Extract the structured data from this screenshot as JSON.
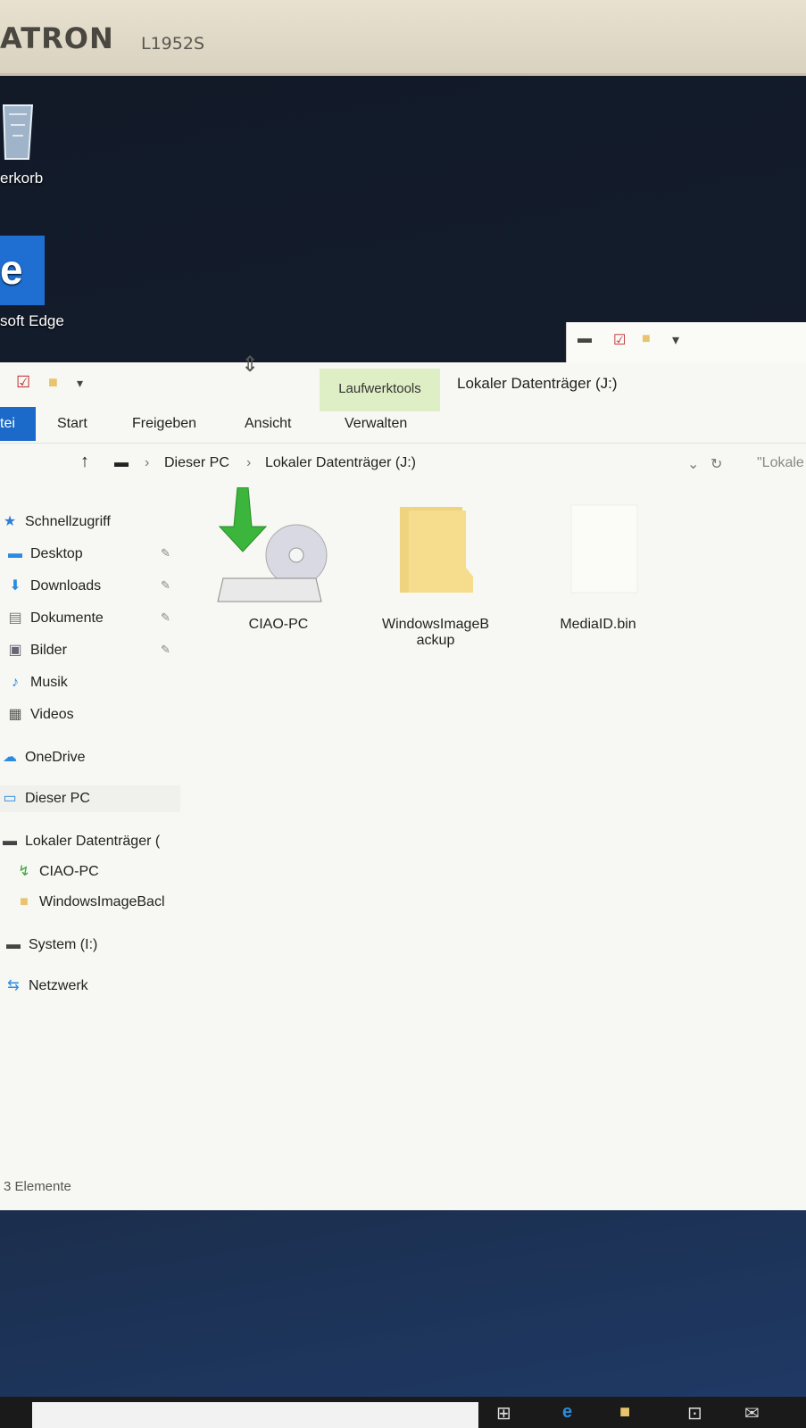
{
  "monitor": {
    "brand": "ATRON",
    "model": "L1952S"
  },
  "desktop": {
    "icons": [
      {
        "label": "erkorb"
      },
      {
        "label": "soft Edge",
        "glyph": "e"
      }
    ]
  },
  "explorer": {
    "context_tab": "Laufwerktools",
    "title": "Lokaler Datenträger (J:)",
    "ribbon_tabs": [
      "tei",
      "Start",
      "Freigeben",
      "Ansicht",
      "Verwalten"
    ],
    "address": {
      "crumb1": "Dieser PC",
      "crumb2": "Lokaler Datenträger (J:)",
      "search_placeholder": "\"Lokale"
    },
    "nav": [
      {
        "label": "Schnellzugriff",
        "icon": "star-icon"
      },
      {
        "label": "Desktop",
        "icon": "desktop-icon",
        "pinned": true
      },
      {
        "label": "Downloads",
        "icon": "download-icon",
        "pinned": true
      },
      {
        "label": "Dokumente",
        "icon": "document-icon",
        "pinned": true
      },
      {
        "label": "Bilder",
        "icon": "picture-icon",
        "pinned": true
      },
      {
        "label": "Musik",
        "icon": "music-icon"
      },
      {
        "label": "Videos",
        "icon": "video-icon"
      },
      {
        "label": "OneDrive",
        "icon": "cloud-icon"
      },
      {
        "label": "Dieser PC",
        "icon": "computer-icon"
      },
      {
        "label": "Lokaler Datenträger (",
        "icon": "drive-icon"
      },
      {
        "label": "CIAO-PC",
        "icon": "backup-icon"
      },
      {
        "label": "WindowsImageBacl",
        "icon": "folder-icon"
      },
      {
        "label": "System (I:)",
        "icon": "drive-icon"
      },
      {
        "label": "Netzwerk",
        "icon": "network-icon"
      }
    ],
    "files": [
      {
        "name": "CIAO-PC",
        "icon": "backup-drive-icon"
      },
      {
        "name": "WindowsImageB\nackup",
        "icon": "folder-icon"
      },
      {
        "name": "MediaID.bin",
        "icon": "file-icon"
      }
    ],
    "status": "3 Elemente"
  }
}
